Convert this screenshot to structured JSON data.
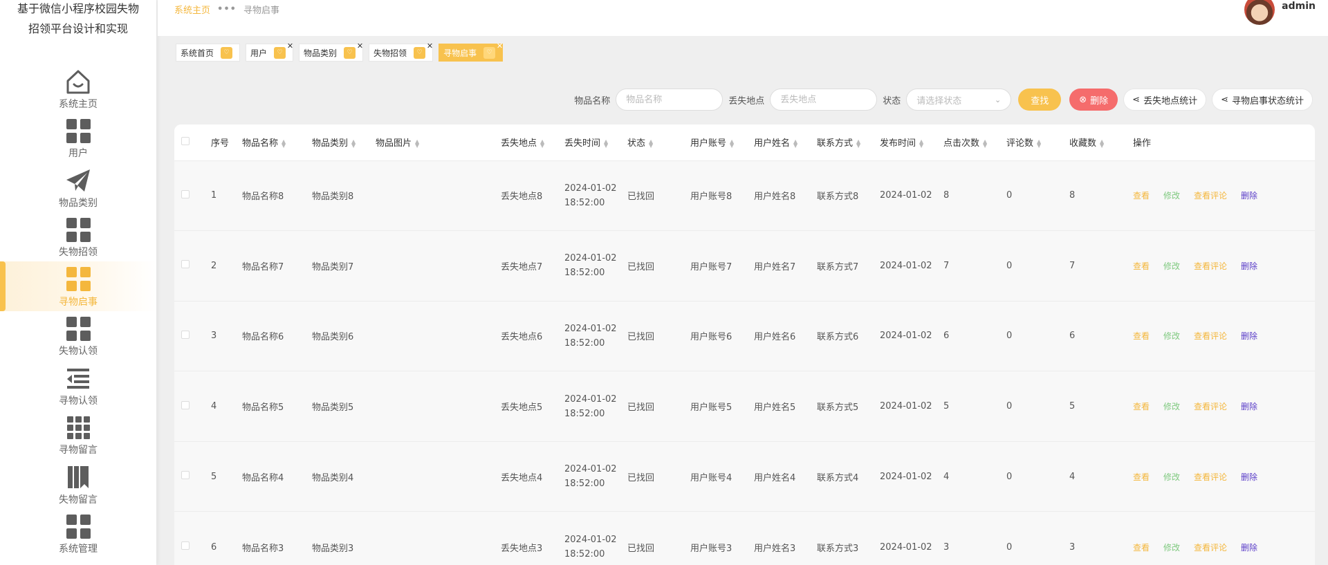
{
  "app": {
    "title_line1": "基于微信小程序校园失物",
    "title_line2": "招领平台设计和实现"
  },
  "sidebar": {
    "items": [
      {
        "label": "系统主页",
        "icon": "home-icon"
      },
      {
        "label": "用户",
        "icon": "grid-icon"
      },
      {
        "label": "物品类别",
        "icon": "paper-plane-icon"
      },
      {
        "label": "失物招领",
        "icon": "grid-icon"
      },
      {
        "label": "寻物启事",
        "icon": "grid-icon",
        "active": true
      },
      {
        "label": "失物认领",
        "icon": "grid-icon"
      },
      {
        "label": "寻物认领",
        "icon": "list-indent-icon"
      },
      {
        "label": "寻物留言",
        "icon": "grid9-icon"
      },
      {
        "label": "失物留言",
        "icon": "books-icon"
      },
      {
        "label": "系统管理",
        "icon": "grid-icon"
      }
    ]
  },
  "header": {
    "breadcrumb_home": "系统主页",
    "breadcrumb_sep": "•••",
    "breadcrumb_current": "寻物启事",
    "username": "admin"
  },
  "tabs": [
    {
      "label": "系统首页",
      "closable": false
    },
    {
      "label": "用户",
      "closable": true
    },
    {
      "label": "物品类别",
      "closable": true
    },
    {
      "label": "失物招领",
      "closable": true
    },
    {
      "label": "寻物启事",
      "closable": true,
      "active": true
    }
  ],
  "search": {
    "item_name_label": "物品名称",
    "item_name_placeholder": "物品名称",
    "location_label": "丢失地点",
    "location_placeholder": "丢失地点",
    "status_label": "状态",
    "status_placeholder": "请选择状态",
    "search_button": "查找",
    "delete_button": "删除",
    "stat_location_button": "丢失地点统计",
    "stat_status_button": "寻物启事状态统计"
  },
  "table": {
    "headers": [
      "序号",
      "物品名称",
      "物品类别",
      "物品图片",
      "丢失地点",
      "丢失时间",
      "状态",
      "用户账号",
      "用户姓名",
      "联系方式",
      "发布时间",
      "点击次数",
      "评论数",
      "收藏数",
      "操作"
    ],
    "actions": {
      "view": "查看",
      "edit": "修改",
      "comments": "查看评论",
      "delete": "删除"
    },
    "rows": [
      {
        "no": "1",
        "name": "物品名称8",
        "category": "物品类别8",
        "location": "丢失地点8",
        "date": "2024-01-02",
        "time": "18:52:00",
        "status": "已找回",
        "account": "用户账号8",
        "user": "用户姓名8",
        "contact": "联系方式8",
        "publish": "2024-01-02",
        "clicks": "8",
        "comments": "0",
        "favorites": "8"
      },
      {
        "no": "2",
        "name": "物品名称7",
        "category": "物品类别7",
        "location": "丢失地点7",
        "date": "2024-01-02",
        "time": "18:52:00",
        "status": "已找回",
        "account": "用户账号7",
        "user": "用户姓名7",
        "contact": "联系方式7",
        "publish": "2024-01-02",
        "clicks": "7",
        "comments": "0",
        "favorites": "7"
      },
      {
        "no": "3",
        "name": "物品名称6",
        "category": "物品类别6",
        "location": "丢失地点6",
        "date": "2024-01-02",
        "time": "18:52:00",
        "status": "已找回",
        "account": "用户账号6",
        "user": "用户姓名6",
        "contact": "联系方式6",
        "publish": "2024-01-02",
        "clicks": "6",
        "comments": "0",
        "favorites": "6"
      },
      {
        "no": "4",
        "name": "物品名称5",
        "category": "物品类别5",
        "location": "丢失地点5",
        "date": "2024-01-02",
        "time": "18:52:00",
        "status": "已找回",
        "account": "用户账号5",
        "user": "用户姓名5",
        "contact": "联系方式5",
        "publish": "2024-01-02",
        "clicks": "5",
        "comments": "0",
        "favorites": "5"
      },
      {
        "no": "5",
        "name": "物品名称4",
        "category": "物品类别4",
        "location": "丢失地点4",
        "date": "2024-01-02",
        "time": "18:52:00",
        "status": "已找回",
        "account": "用户账号4",
        "user": "用户姓名4",
        "contact": "联系方式4",
        "publish": "2024-01-02",
        "clicks": "4",
        "comments": "0",
        "favorites": "4"
      },
      {
        "no": "6",
        "name": "物品名称3",
        "category": "物品类别3",
        "location": "丢失地点3",
        "date": "2024-01-02",
        "time": "18:52:00",
        "status": "已找回",
        "account": "用户账号3",
        "user": "用户姓名3",
        "contact": "联系方式3",
        "publish": "2024-01-02",
        "clicks": "3",
        "comments": "0",
        "favorites": "3"
      }
    ]
  }
}
